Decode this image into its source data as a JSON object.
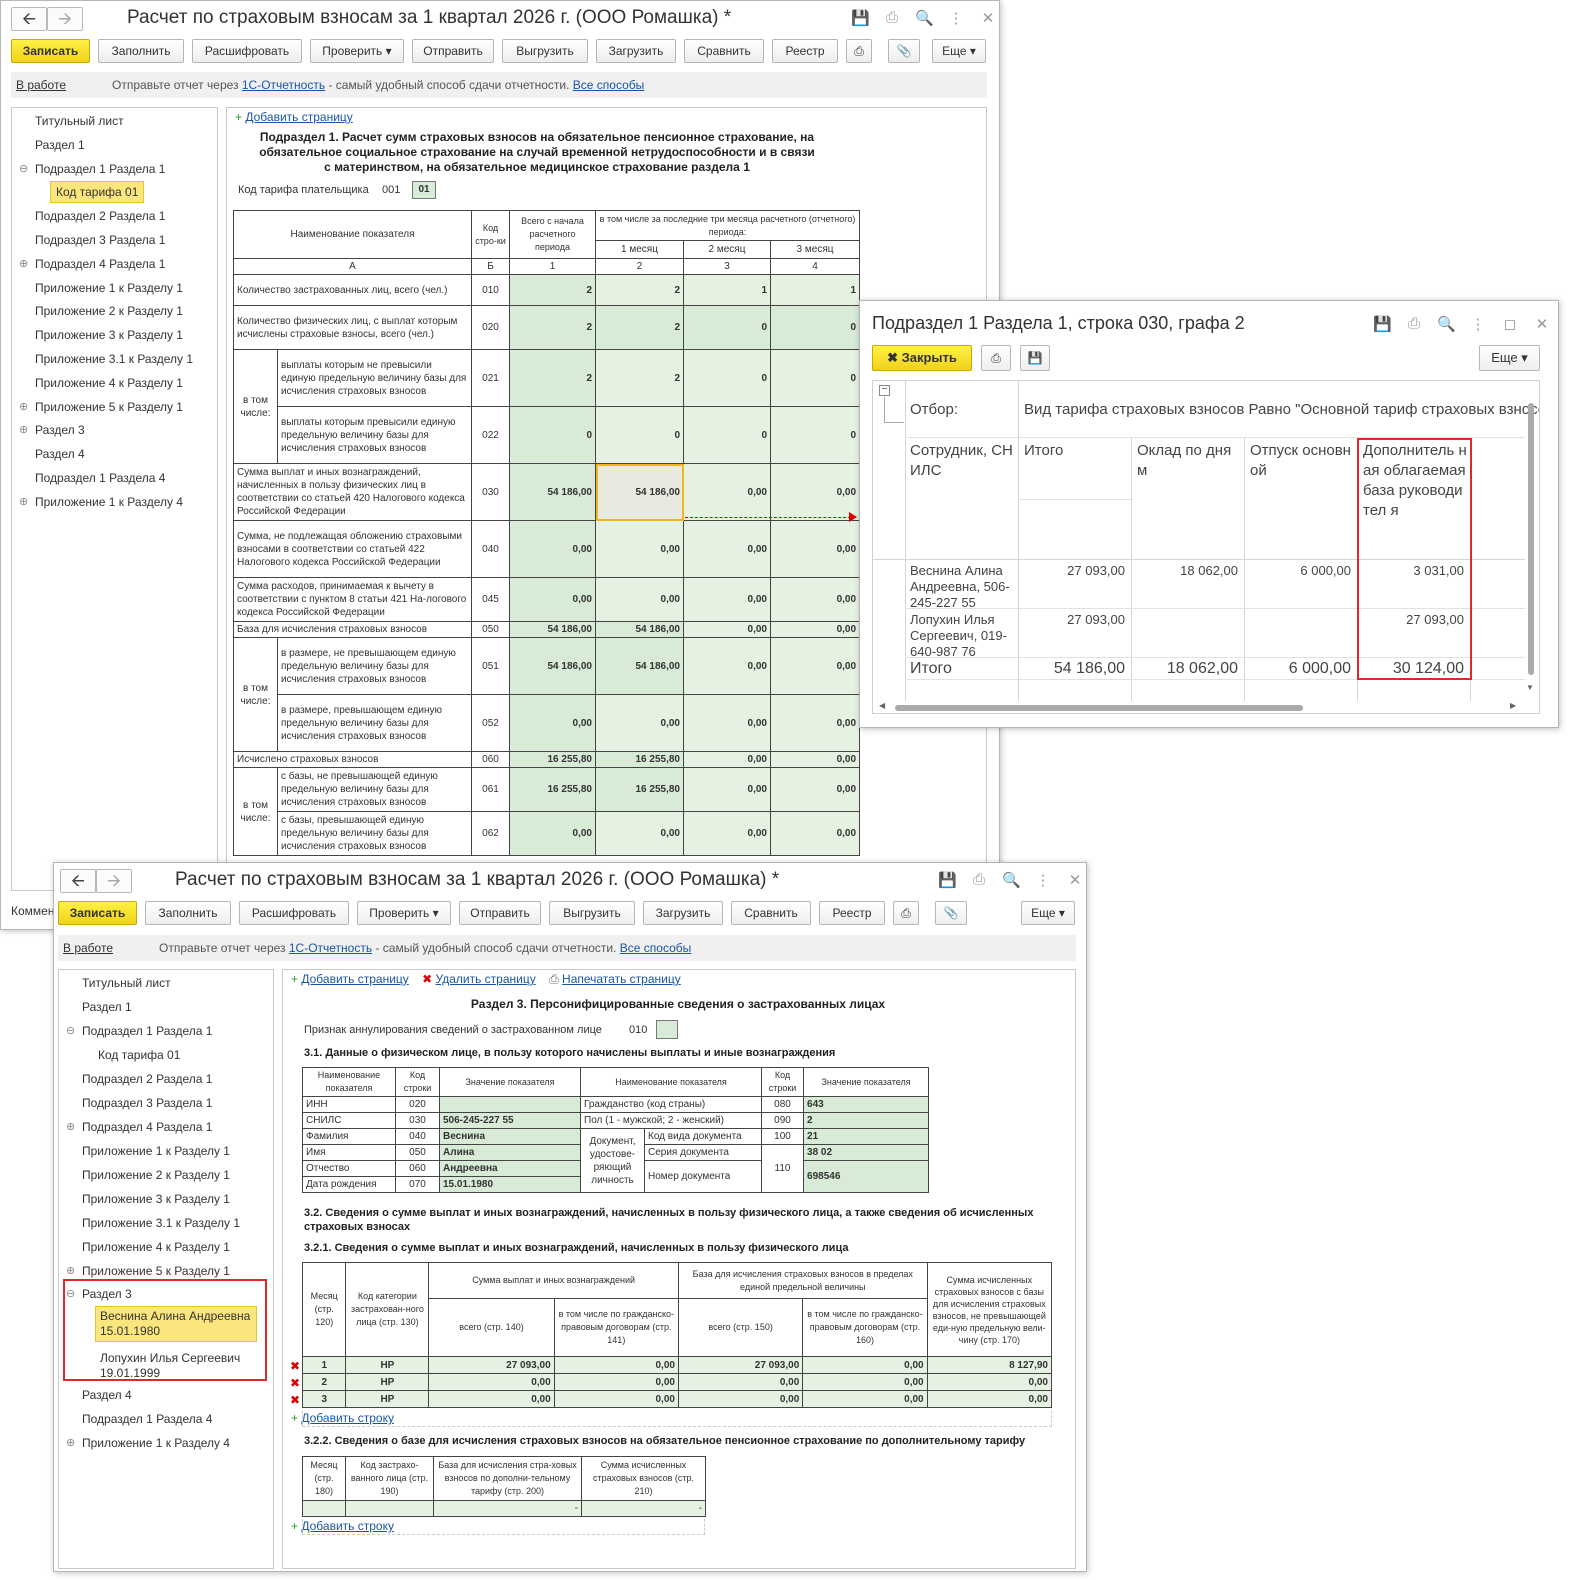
{
  "w1": {
    "title": "Расчет по страховым взносам за 1 квартал 2026 г. (ООО Ромашка) *",
    "toolbar": {
      "save": "Записать",
      "fill": "Заполнить",
      "decode": "Расшифровать",
      "check": "Проверить",
      "send": "Отправить",
      "upload": "Выгрузить",
      "load": "Загрузить",
      "compare": "Сравнить",
      "registry": "Реестр",
      "more": "Еще"
    },
    "info": {
      "status": "В работе",
      "text1": "Отправьте отчет через ",
      "link1": "1С-Отчетность",
      "text2": " - самый удобный способ сдачи отчетности. ",
      "link2": "Все способы"
    },
    "tree": [
      "Титульный лист",
      "Раздел 1",
      "Подраздел 1 Раздела 1",
      "Код тарифа 01",
      "Подраздел 2 Раздела 1",
      "Подраздел 3 Раздела 1",
      "Подраздел 4 Раздела 1",
      "Приложение 1 к Разделу 1",
      "Приложение 2 к Разделу 1",
      "Приложение 3 к Разделу 1",
      "Приложение 3.1 к Разделу 1",
      "Приложение 4 к Разделу 1",
      "Приложение 5 к Разделу 1",
      "Раздел 3",
      "Раздел 4",
      "Подраздел 1 Раздела 4",
      "Приложение 1 к Разделу 4"
    ],
    "comment": "Коммен",
    "add_page": "Добавить страницу",
    "heading": "Подраздел 1. Расчет сумм страховых взносов на обязательное пенсионное страхование, на обязательное социальное страхование на случай временной нетрудоспособности и в связи с материнством, на обязательное медицинское страхование раздела 1",
    "tariff_label": "Код тарифа плательщика",
    "tariff_code": "001",
    "tariff_value": "01",
    "head": {
      "name": "Наименование показателя",
      "code": "Код стро-ки",
      "total": "Всего с начала расчетного периода",
      "last3": "в том числе за последние три месяца расчетного (отчетного) периода:",
      "m1": "1 месяц",
      "m2": "2 месяц",
      "m3": "3 месяц",
      "nA": "А",
      "nB": "Б",
      "n1": "1",
      "n2": "2",
      "n3": "3",
      "n4": "4"
    },
    "incl": "в том числе:",
    "rows": [
      {
        "name": "Количество застрахованных лиц, всего (чел.)",
        "code": "010",
        "v": [
          "2",
          "2",
          "1",
          "1"
        ]
      },
      {
        "name": "Количество физических лиц, с выплат которым исчислены страховые взносы, всего (чел.)",
        "code": "020",
        "v": [
          "2",
          "2",
          "0",
          "0"
        ]
      },
      {
        "name": "выплаты которым не превысили единую предельную величину базы для исчисления страховых взносов",
        "code": "021",
        "v": [
          "2",
          "2",
          "0",
          "0"
        ]
      },
      {
        "name": "выплаты которым превысили единую предельную величину базы для исчисления страховых взносов",
        "code": "022",
        "v": [
          "0",
          "0",
          "0",
          "0"
        ]
      },
      {
        "name": "Сумма выплат и иных вознаграждений, начисленных в пользу физических лиц в соответствии со статьей 420 Налогового кодекса Российской Федерации",
        "code": "030",
        "v": [
          "54 186,00",
          "54 186,00",
          "0,00",
          "0,00"
        ]
      },
      {
        "name": "Сумма, не подлежащая обложению страховыми взносами в соответствии со статьей 422 Налогового кодекса Российской  Федерации",
        "code": "040",
        "v": [
          "0,00",
          "0,00",
          "0,00",
          "0,00"
        ]
      },
      {
        "name": "Сумма расходов, принимаемая к вычету в соответствии с пунктом 8 статьи 421 На-логового кодекса Российской Федерации",
        "code": "045",
        "v": [
          "0,00",
          "0,00",
          "0,00",
          "0,00"
        ]
      },
      {
        "name": "База для исчисления страховых взносов",
        "code": "050",
        "v": [
          "54 186,00",
          "54 186,00",
          "0,00",
          "0,00"
        ]
      },
      {
        "name": "в размере, не превышающем единую предельную величину базы для исчисления страховых взносов",
        "code": "051",
        "v": [
          "54 186,00",
          "54 186,00",
          "0,00",
          "0,00"
        ]
      },
      {
        "name": "в размере, превышающем единую предельную величину базы для исчисления страховых взносов",
        "code": "052",
        "v": [
          "0,00",
          "0,00",
          "0,00",
          "0,00"
        ]
      },
      {
        "name": "Исчислено страховых взносов",
        "code": "060",
        "v": [
          "16 255,80",
          "16 255,80",
          "0,00",
          "0,00"
        ]
      },
      {
        "name": "с базы, не превышающей единую предельную величину базы для исчисления страховых взносов",
        "code": "061",
        "v": [
          "16 255,80",
          "16 255,80",
          "0,00",
          "0,00"
        ]
      },
      {
        "name": "с базы, превышающей единую предельную величину базы для исчисления страховых взносов",
        "code": "062",
        "v": [
          "0,00",
          "0,00",
          "0,00",
          "0,00"
        ]
      }
    ]
  },
  "w2": {
    "title": "Подраздел 1 Раздела 1, строка 030, графа 2",
    "close": "Закрыть",
    "more": "Еще",
    "filter_label": "Отбор:",
    "filter_value": "Вид тарифа страховых взносов Равно \"Основной тариф страховых взносов\"",
    "cols": [
      "Сотрудник, СНИЛС",
      "Итого",
      "Оклад по дням",
      "Отпуск основной",
      "Дополнитель ная облагаемая база руководител я"
    ],
    "rows": [
      {
        "name": "Веснина Алина Андреевна, 506-245-227 55",
        "v": [
          "27 093,00",
          "18 062,00",
          "6 000,00",
          "3 031,00"
        ]
      },
      {
        "name": "Лопухин Илья Сергеевич, 019-640-987 76",
        "v": [
          "27 093,00",
          "",
          "",
          "27 093,00"
        ]
      }
    ],
    "total": {
      "name": "Итого",
      "v": [
        "54 186,00",
        "18 062,00",
        "6 000,00",
        "30 124,00"
      ]
    }
  },
  "w3": {
    "title": "Расчет по страховым взносам за 1 квартал 2026 г. (ООО Ромашка) *",
    "add_page": "Добавить страницу",
    "del_page": "Удалить страницу",
    "print_page": "Напечатать страницу",
    "tree": [
      "Титульный лист",
      "Раздел 1",
      "Подраздел 1 Раздела 1",
      "Код тарифа 01",
      "Подраздел 2 Раздела 1",
      "Подраздел 3 Раздела 1",
      "Подраздел 4 Раздела 1",
      "Приложение 1 к Разделу 1",
      "Приложение 2 к Разделу 1",
      "Приложение 3 к Разделу 1",
      "Приложение 3.1 к Разделу 1",
      "Приложение 4 к Разделу 1",
      "Приложение 5 к Разделу 1",
      "Раздел 3",
      "Веснина Алина Андреевна",
      "15.01.1980",
      "Лопухин Илья Сергеевич",
      "19.01.1999",
      "Раздел 4",
      "Подраздел 1 Раздела 4",
      "Приложение 1 к Разделу 4"
    ],
    "heading": "Раздел 3. Персонифицированные сведения о застрахованных лицах",
    "annul_label": "Признак аннулирования сведений о застрахованном лице",
    "annul_code": "010",
    "s31": "3.1. Данные о физическом лице, в пользу которого начислены выплаты и иные вознаграждения",
    "p": {
      "h_name": "Наименование показателя",
      "h_code": "Код строки",
      "h_value": "Значение показателя",
      "inn": "ИНН",
      "inn_c": "020",
      "inn_v": "",
      "snils": "СНИЛС",
      "snils_c": "030",
      "snils_v": "506-245-227 55",
      "fam": "Фамилия",
      "fam_c": "040",
      "fam_v": "Веснина",
      "imya": "Имя",
      "imya_c": "050",
      "imya_v": "Алина",
      "otch": "Отчество",
      "otch_c": "060",
      "otch_v": "Андреевна",
      "dr": "Дата рождения",
      "dr_c": "070",
      "dr_v": "15.01.1980",
      "grazh": "Гражданство (код страны)",
      "grazh_c": "080",
      "grazh_v": "643",
      "pol": "Пол (1 - мужской; 2 - женский)",
      "pol_c": "090",
      "pol_v": "2",
      "doc": "Документ, удостове-ряющий личность",
      "kod": "Код вида документа",
      "kod_c": "100",
      "kod_v": "21",
      "ser": "Серия документа",
      "ser_v": "38 02",
      "num": "Номер документа",
      "doc_c": "110",
      "num_v": "698546"
    },
    "s32": "3.2. Сведения о сумме выплат и иных вознаграждений, начисленных в пользу физического лица, а также сведения об исчисленных страховых взносах",
    "s321": "3.2.1. Сведения о сумме выплат и иных вознаграждений, начисленных в пользу физического лица",
    "t321h": {
      "month": "Месяц (стр. 120)",
      "cat": "Код категории застрахован-ного лица (стр. 130)",
      "sum": "Сумма выплат и иных вознаграждений",
      "base": "База для исчисления страховых взносов в пределах единой предельной величины",
      "contrib": "Сумма исчисленных страховых взносов с базы для исчисления страховых взносов, не превышающей еди-ную предельную вели-чину (стр. 170)",
      "all140": "всего (стр. 140)",
      "gpd141": "в том числе по гражданско-правовым договорам (стр. 141)",
      "all150": "всего (стр. 150)",
      "gpd160": "в том числе по гражданско-правовым договорам (стр. 160)"
    },
    "t321": [
      {
        "m": "1",
        "cat": "НР",
        "v": [
          "27 093,00",
          "0,00",
          "27 093,00",
          "0,00",
          "8 127,90"
        ]
      },
      {
        "m": "2",
        "cat": "НР",
        "v": [
          "0,00",
          "0,00",
          "0,00",
          "0,00",
          "0,00"
        ]
      },
      {
        "m": "3",
        "cat": "НР",
        "v": [
          "0,00",
          "0,00",
          "0,00",
          "0,00",
          "0,00"
        ]
      }
    ],
    "add_row": "Добавить строку",
    "s322": "3.2.2. Сведения о базе для исчисления страховых взносов на обязательное пенсионное страхование по дополнительному тарифу",
    "t322h": {
      "month": "Месяц (стр. 180)",
      "code": "Код застрахо-ванного лица (стр. 190)",
      "base": "База для исчисления стра-ховых взносов по дополни-тельному тарифу (стр. 200)",
      "sum": "Сумма исчисленных страховых взносов (стр. 210)"
    },
    "t322": {
      "base": "-",
      "sum": "-"
    }
  }
}
